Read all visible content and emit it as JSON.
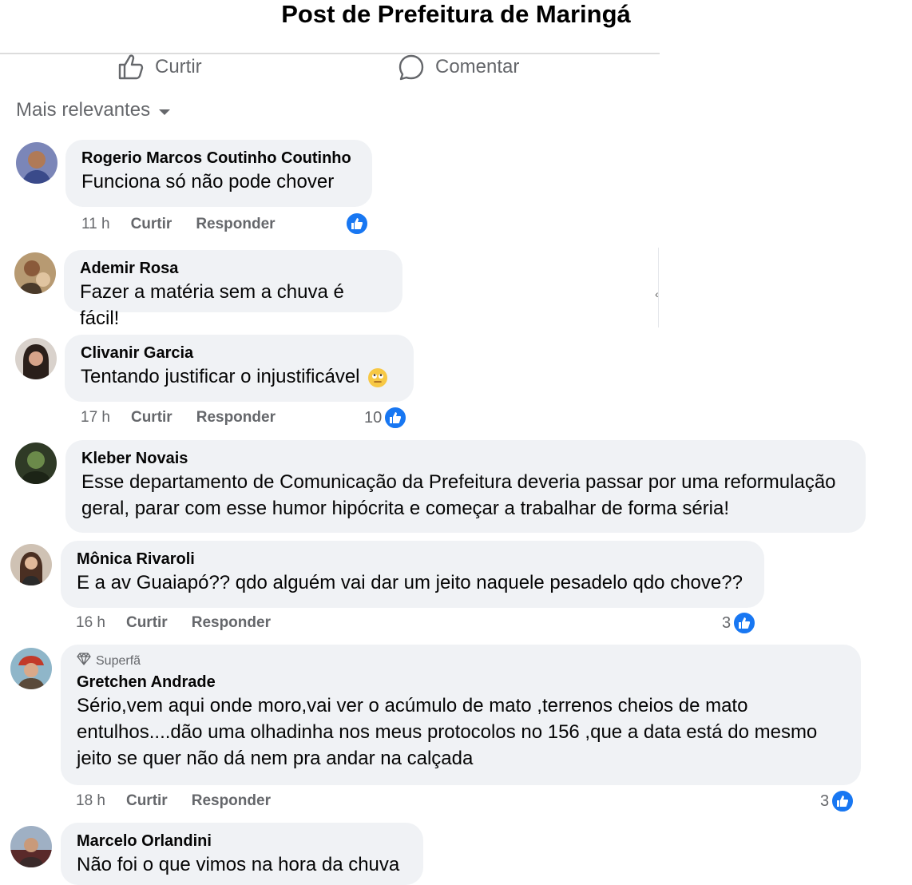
{
  "title": "Post de Prefeitura de Maringá",
  "actions": {
    "like_label": "Curtir",
    "comment_label": "Comentar"
  },
  "sort": {
    "label": "Mais relevantes"
  },
  "comment_actions": {
    "like": "Curtir",
    "reply": "Responder"
  },
  "comments": [
    {
      "author": "Rogerio Marcos Coutinho Coutinho",
      "text": "Funciona só não pode chover",
      "time": "11 h",
      "reactions": ""
    },
    {
      "author": "Ademir Rosa",
      "text": "Fazer a matéria sem a chuva é fácil!"
    },
    {
      "author": "Clivanir Garcia",
      "text": "Tentando justificar o injustificável",
      "time": "17 h",
      "reactions": "10"
    },
    {
      "author": "Kleber Novais",
      "text": "Esse departamento de Comunicação da Prefeitura deveria passar por uma reformulação geral, parar com esse humor hipócrita e começar a trabalhar de forma séria!"
    },
    {
      "author": "Mônica Rivaroli",
      "text": "E a av Guaiapó?? qdo alguém vai dar um jeito naquele pesadelo qdo chove??",
      "time": "16 h",
      "reactions": "3"
    },
    {
      "badge": "Superfã",
      "author": "Gretchen Andrade",
      "text": "Sério,vem aqui onde moro,vai ver o acúmulo de mato ,terrenos cheios de mato entulhos....dão uma olhadinha nos meus protocolos no 156 ,que a data está do mesmo jeito se quer não dá nem pra andar na calçada",
      "time": "18 h",
      "reactions": "3"
    },
    {
      "author": "Marcelo Orlandini",
      "text": "Não foi o que vimos na hora da chuva"
    }
  ],
  "colors": {
    "like_blue": "#1877f2",
    "bubble": "#f0f2f5",
    "meta_gray": "#65676b"
  }
}
